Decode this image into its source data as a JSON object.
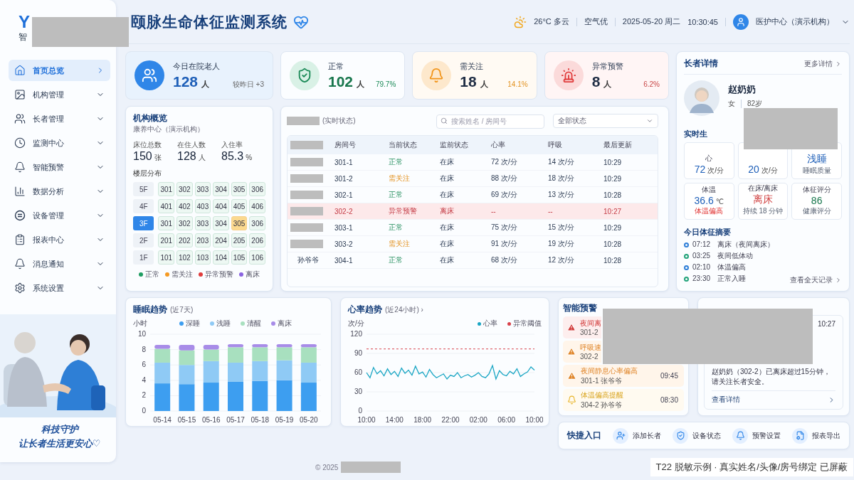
{
  "logo": {
    "mark": "Y",
    "text": "智"
  },
  "sidebar": {
    "items": [
      {
        "label": "首页总览",
        "selected": true
      },
      {
        "label": "机构管理",
        "selected": false
      },
      {
        "label": "长者管理",
        "selected": false
      },
      {
        "label": "监测中心",
        "selected": false
      },
      {
        "label": "智能预警",
        "selected": false
      },
      {
        "label": "数据分析",
        "selected": false
      },
      {
        "label": "设备管理",
        "selected": false
      },
      {
        "label": "报表中心",
        "selected": false
      },
      {
        "label": "消息通知",
        "selected": false
      },
      {
        "label": "系统设置",
        "selected": false
      }
    ],
    "slogan": [
      "科技守护",
      "让长者生活更安心♡"
    ]
  },
  "header": {
    "title": "颐脉生命体征监测系统",
    "weather": "26°C 多云",
    "air": "空气优",
    "date": "2025-05-20 周二",
    "time": "10:30:45",
    "user": "医护中心（演示机构）"
  },
  "stats": [
    {
      "kind": "total",
      "label": "今日在院老人",
      "value": "128",
      "unit": "人",
      "extra": "较昨日 +3"
    },
    {
      "kind": "normal",
      "label": "正常",
      "value": "102",
      "unit": "人",
      "extra": "79.7%"
    },
    {
      "kind": "attention",
      "label": "需关注",
      "value": "18",
      "unit": "人",
      "extra": "14.1%"
    },
    {
      "kind": "alarm",
      "label": "异常预警",
      "value": "8",
      "unit": "人",
      "extra": "6.2%"
    }
  ],
  "overview": {
    "title": "机构概览",
    "subtitle": "康养中心（演示机构）",
    "metrics": [
      {
        "label": "床位总数",
        "value": "150",
        "unit": "张"
      },
      {
        "label": "在住人数",
        "value": "128",
        "unit": "人"
      },
      {
        "label": "入住率",
        "value": "85.3",
        "unit": "%"
      }
    ],
    "floor_title": "楼层分布",
    "floors": [
      {
        "label": "5F",
        "selected": false,
        "rooms": [
          {
            "no": "301",
            "attention": false
          },
          {
            "no": "302",
            "attention": false
          },
          {
            "no": "303",
            "attention": false
          },
          {
            "no": "304",
            "attention": false
          },
          {
            "no": "305",
            "attention": false
          },
          {
            "no": "306",
            "attention": false
          }
        ]
      },
      {
        "label": "4F",
        "selected": false,
        "rooms": [
          {
            "no": "401",
            "attention": false
          },
          {
            "no": "402",
            "attention": false
          },
          {
            "no": "403",
            "attention": false
          },
          {
            "no": "404",
            "attention": false
          },
          {
            "no": "405",
            "attention": false
          },
          {
            "no": "406",
            "attention": false
          }
        ]
      },
      {
        "label": "3F",
        "selected": true,
        "rooms": [
          {
            "no": "301",
            "attention": false
          },
          {
            "no": "302",
            "attention": false
          },
          {
            "no": "303",
            "attention": false
          },
          {
            "no": "304",
            "attention": false
          },
          {
            "no": "305",
            "attention": true
          },
          {
            "no": "306",
            "attention": false
          }
        ]
      },
      {
        "label": "2F",
        "selected": false,
        "rooms": [
          {
            "no": "201",
            "attention": false
          },
          {
            "no": "202",
            "attention": false
          },
          {
            "no": "203",
            "attention": false
          },
          {
            "no": "204",
            "attention": false
          },
          {
            "no": "205",
            "attention": false
          },
          {
            "no": "206",
            "attention": false
          }
        ]
      },
      {
        "label": "1F",
        "selected": false,
        "rooms": [
          {
            "no": "101",
            "attention": false
          },
          {
            "no": "102",
            "attention": false
          },
          {
            "no": "103",
            "attention": false
          },
          {
            "no": "104",
            "attention": false
          },
          {
            "no": "105",
            "attention": false
          },
          {
            "no": "106",
            "attention": false
          }
        ]
      }
    ],
    "legend": [
      {
        "label": "正常",
        "color": "#1f9d62"
      },
      {
        "label": "需关注",
        "color": "#f59a23"
      },
      {
        "label": "异常预警",
        "color": "#e03c3c"
      },
      {
        "label": "离床",
        "color": "#8a63e0"
      }
    ]
  },
  "table": {
    "title": "(实时状态)",
    "search_placeholder": "搜索姓名 / 房间号",
    "filter": "全部状态",
    "columns": [
      "房间号",
      "当前状态",
      "监前状态",
      "心率",
      "呼吸",
      "最后更新"
    ],
    "rows": [
      {
        "redacted": true,
        "room": "301-1",
        "kind": "normal",
        "state": "正常",
        "bed": "在床",
        "hr": "72 次/分",
        "resp": "14 次/分",
        "updated": "10:29"
      },
      {
        "redacted": true,
        "room": "301-2",
        "kind": "attention",
        "state": "需关注",
        "bed": "在床",
        "hr": "88 次/分",
        "resp": "18 次/分",
        "updated": "10:29"
      },
      {
        "redacted": true,
        "room": "302-1",
        "kind": "normal",
        "state": "正常",
        "bed": "在床",
        "hr": "69 次/分",
        "resp": "13 次/分",
        "updated": "10:28"
      },
      {
        "redacted": true,
        "room": "302-2",
        "kind": "alarm",
        "state": "异常预警",
        "bed": "离床",
        "hr": "--",
        "resp": "--",
        "updated": "10:27"
      },
      {
        "redacted": true,
        "room": "303-1",
        "kind": "normal",
        "state": "正常",
        "bed": "在床",
        "hr": "75 次/分",
        "resp": "15 次/分",
        "updated": "10:29"
      },
      {
        "redacted": true,
        "room": "303-2",
        "kind": "attention",
        "state": "需关注",
        "bed": "在床",
        "hr": "91 次/分",
        "resp": "19 次/分",
        "updated": "10:28"
      },
      {
        "redacted": false,
        "name": "孙爷爷",
        "room": "304-1",
        "kind": "normal",
        "state": "正常",
        "bed": "在床",
        "hr": "68 次/分",
        "resp": "12 次/分",
        "updated": "10:28"
      }
    ]
  },
  "elder": {
    "title": "长者详情",
    "more": "更多详情",
    "name": "赵奶奶",
    "gender": "女",
    "age": "82岁",
    "vitals_title": "实时生",
    "vitals": [
      {
        "label": "心",
        "value": "72",
        "unit": "次/分",
        "kind": "normal"
      },
      {
        "value": "20",
        "unit": "次/分",
        "kind": "normal"
      },
      {
        "value": "浅睡",
        "note": "睡眠质量",
        "kind": "normal",
        "note_alarm": false
      },
      {
        "label": "体温",
        "value": "36.6",
        "unit": "℃",
        "note": "体温偏高",
        "kind": "normal",
        "note_alarm": true
      },
      {
        "label": "在床/离床",
        "value": "离床",
        "note": "持续 18 分钟",
        "kind": "alarm",
        "note_alarm": false
      },
      {
        "label": "体征评分",
        "value": "86",
        "note": "健康评分",
        "kind": "good",
        "note_alarm": false
      }
    ],
    "summary_title": "今日体征摘要",
    "summary": [
      {
        "time": "07:12",
        "text": "离床（夜间离床）",
        "color": "#2f7fd8"
      },
      {
        "time": "03:25",
        "text": "夜间低体动",
        "color": "#22a37a"
      },
      {
        "time": "02:10",
        "text": "体温偏高",
        "color": "#2f7fd8"
      },
      {
        "time": "23:30",
        "text": "正常入睡",
        "color": "#22a37a"
      }
    ],
    "all_records": "查看全天记录"
  },
  "sleep": {
    "title": "睡眠趋势",
    "sub": "(近7天)",
    "chart_data": {
      "type": "bar",
      "stacked": true,
      "grid": true,
      "ylabel": "小时",
      "categories": [
        "05-14",
        "05-15",
        "05-16",
        "05-17",
        "05-18",
        "05-19",
        "05-20"
      ],
      "ylim": [
        0,
        10
      ],
      "yticks": [
        0,
        2,
        4,
        6,
        8,
        10
      ],
      "series": [
        {
          "name": "深睡",
          "color": "#3d9ef0",
          "values": [
            3.6,
            3.5,
            3.7,
            3.8,
            3.9,
            4.0,
            3.7
          ]
        },
        {
          "name": "浅睡",
          "color": "#8fcaf5",
          "values": [
            2.7,
            2.5,
            2.8,
            2.5,
            2.6,
            2.6,
            2.6
          ]
        },
        {
          "name": "清醒",
          "color": "#a8e0bf",
          "values": [
            1.8,
            1.9,
            1.5,
            2.0,
            1.8,
            1.7,
            2.0
          ]
        },
        {
          "name": "离床",
          "color": "#a88ce8",
          "values": [
            0.5,
            0.7,
            0.6,
            0.4,
            0.4,
            0.4,
            0.4
          ]
        }
      ]
    }
  },
  "heart": {
    "title": "心率趋势",
    "sub": "(近24小时) ›",
    "chart_data": {
      "type": "line",
      "grid": true,
      "ylabel": "次/分",
      "ylim": [
        0,
        120
      ],
      "yticks": [
        0,
        30,
        60,
        90,
        120
      ],
      "categories": [
        "10:00",
        null,
        null,
        null,
        null,
        null,
        null,
        null,
        "14:00",
        null,
        null,
        null,
        null,
        null,
        null,
        null,
        "18:00",
        null,
        null,
        null,
        null,
        null,
        null,
        null,
        "22:00",
        null,
        null,
        null,
        null,
        null,
        null,
        null,
        "02:00",
        null,
        null,
        null,
        null,
        null,
        null,
        null,
        "06:00",
        null,
        null,
        null,
        null,
        null,
        null,
        null,
        "10:00"
      ],
      "series": [
        {
          "name": "心率",
          "color": "#1aa6c4",
          "line_style": "solid",
          "values": [
            60,
            52,
            68,
            58,
            63,
            55,
            66,
            57,
            62,
            54,
            67,
            59,
            64,
            56,
            70,
            58,
            61,
            53,
            65,
            57,
            52,
            55,
            58,
            50,
            56,
            54,
            60,
            52,
            55,
            57,
            53,
            56,
            60,
            54,
            52,
            58,
            71,
            50,
            63,
            57,
            55,
            62,
            58,
            66,
            54,
            58,
            61,
            69,
            64
          ]
        },
        {
          "name": "异常阈值",
          "color": "#d9414b",
          "line_style": "dashed",
          "values": [
            97,
            97,
            97,
            97,
            97,
            97,
            97,
            97,
            97,
            97,
            97,
            97,
            97,
            97,
            97,
            97,
            97,
            97,
            97,
            97,
            97,
            97,
            97,
            97,
            97,
            97,
            97,
            97,
            97,
            97,
            97,
            97,
            97,
            97,
            97,
            97,
            97,
            97,
            97,
            97,
            97,
            97,
            97,
            97,
            97,
            97,
            97,
            97,
            97
          ]
        }
      ]
    }
  },
  "alerts": {
    "title": "智能预警",
    "items": [
      {
        "kind": "alarm",
        "title": "夜间离",
        "meta": "301-2"
      },
      {
        "kind": "warning",
        "title": "呼吸速",
        "meta": "302-2"
      },
      {
        "kind": "warning",
        "title": "夜间静息心率偏高",
        "meta": "301-1 张爷爷",
        "time": "09:45"
      },
      {
        "kind": "notice",
        "title": "体温偏高提醒",
        "meta": "304-2 孙爷爷",
        "time": "08:30"
      }
    ]
  },
  "message": {
    "time": "10:27",
    "text": "赵奶奶（302-2）已离床超过15分钟，请关注长者安全。",
    "link": "查看详情"
  },
  "quick": {
    "title": "快捷入口",
    "items": [
      {
        "label": "添加长者"
      },
      {
        "label": "设备状态"
      },
      {
        "label": "预警设置"
      },
      {
        "label": "报表导出"
      }
    ]
  },
  "footer": {
    "copyright": "© 2025",
    "badge": "T22 脱敏示例 · 真实姓名/头像/房号绑定 已屏蔽"
  }
}
